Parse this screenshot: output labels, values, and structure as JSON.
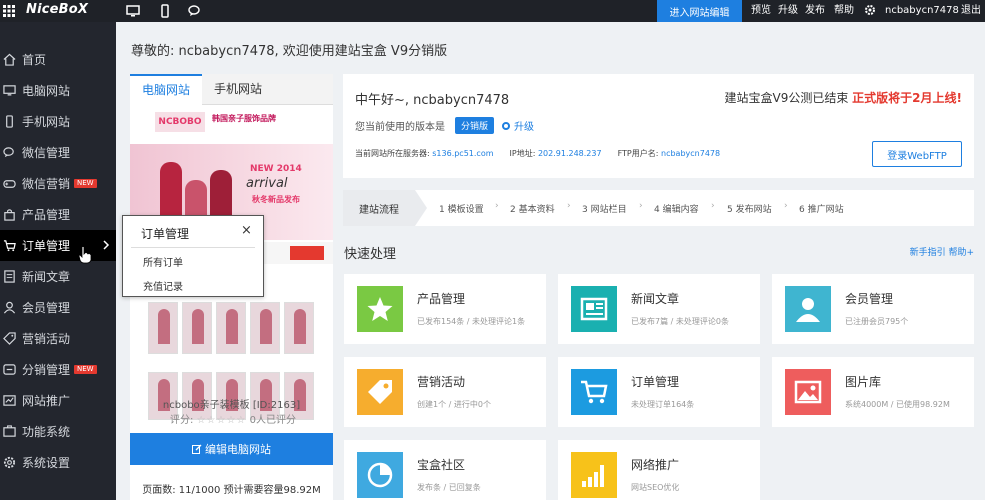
{
  "topbar": {
    "logo": "NiceBoX",
    "enter_site_edit": "进入网站编辑",
    "links": [
      "预览",
      "升级",
      "发布",
      "帮助"
    ],
    "username": "ncbabycn7478",
    "logout": "退出"
  },
  "sidebar": {
    "items": [
      {
        "label": "首页",
        "icon": "home-icon"
      },
      {
        "label": "电脑网站",
        "icon": "monitor-icon"
      },
      {
        "label": "手机网站",
        "icon": "mobile-icon"
      },
      {
        "label": "微信管理",
        "icon": "chat-icon"
      },
      {
        "label": "微信营销",
        "icon": "gamepad-icon",
        "badge": "NEW"
      },
      {
        "label": "产品管理",
        "icon": "bag-icon"
      },
      {
        "label": "订单管理",
        "icon": "cart-icon",
        "active": true
      },
      {
        "label": "新闻文章",
        "icon": "document-icon"
      },
      {
        "label": "会员管理",
        "icon": "user-icon"
      },
      {
        "label": "营销活动",
        "icon": "tag-icon"
      },
      {
        "label": "分销管理",
        "icon": "share-icon",
        "badge": "NEW"
      },
      {
        "label": "网站推广",
        "icon": "chart-icon"
      },
      {
        "label": "功能系统",
        "icon": "function-icon"
      },
      {
        "label": "系统设置",
        "icon": "gear-icon"
      }
    ]
  },
  "flyout": {
    "title": "订单管理",
    "close": "×",
    "items": [
      "所有订单",
      "充值记录"
    ]
  },
  "greeting": "尊敬的: ncbabycn7478, 欢迎使用建站宝盒 V9分销版",
  "preview": {
    "tabs": [
      "电脑网站",
      "手机网站"
    ],
    "thumbnail": {
      "logo": "NCBOBO",
      "brand": "韩国亲子服饰品牌",
      "new": "NEW",
      "year": "2014",
      "arrival": "arrival",
      "sub": "秋冬新品发布"
    },
    "template_name": "ncbobo亲子装模板 [ID:2163]",
    "rating_label": "评分:",
    "rating_stars": "☆☆☆☆☆",
    "rating_count": "0人已评分",
    "edit_button": "编辑电脑网站",
    "stats": "页面数: 11/1000 预计需要容量98.92M"
  },
  "info": {
    "hello": "中午好~, ncbabycn7478",
    "notice_prefix": "建站宝盒V9公测已结束",
    "notice_highlight": "正式版将于2月上线!",
    "version_label": "您当前使用的版本是",
    "version_badge": "分销版",
    "upgrade": "升级",
    "server_label": "当前网站所在服务器:",
    "server_value": "s136.pc51.com",
    "ip_label": "IP地址:",
    "ip_value": "202.91.248.237",
    "ftp_label": "FTP用户名:",
    "ftp_value": "ncbabycn7478",
    "ftp_button": "登录WebFTP"
  },
  "flow": {
    "title": "建站流程",
    "steps": [
      "1  模板设置",
      "2  基本资料",
      "3  网站栏目",
      "4  编辑内容",
      "5  发布网站",
      "6  推广网站"
    ]
  },
  "quick": {
    "title": "快速处理",
    "links": "新手指引  帮助+",
    "cards": [
      {
        "title": "产品管理",
        "sub": "已发布154条 / 未处理评论1条",
        "icon": "star-icon",
        "color": "#7ac943"
      },
      {
        "title": "新闻文章",
        "sub": "已发布7篇 / 未处理评论0条",
        "icon": "news-icon",
        "color": "#1ab0b0"
      },
      {
        "title": "会员管理",
        "sub": "已注册会员795个",
        "icon": "member-icon",
        "color": "#3fb5d0"
      },
      {
        "title": "营销活动",
        "sub": "创建1个 / 进行中0个",
        "icon": "tag-icon",
        "color": "#f6ad2e"
      },
      {
        "title": "订单管理",
        "sub": "未处理订单164条",
        "icon": "cart-icon",
        "color": "#1c9be0"
      },
      {
        "title": "图片库",
        "sub": "系统4000M / 已使用98.92M",
        "icon": "image-icon",
        "color": "#ee5d5d"
      },
      {
        "title": "宝盒社区",
        "sub": "发布条 / 已回复条",
        "icon": "pie-icon",
        "color": "#3fa9e0"
      },
      {
        "title": "网络推广",
        "sub": "网站SEO优化",
        "icon": "signal-icon",
        "color": "#f7c21a"
      }
    ]
  }
}
